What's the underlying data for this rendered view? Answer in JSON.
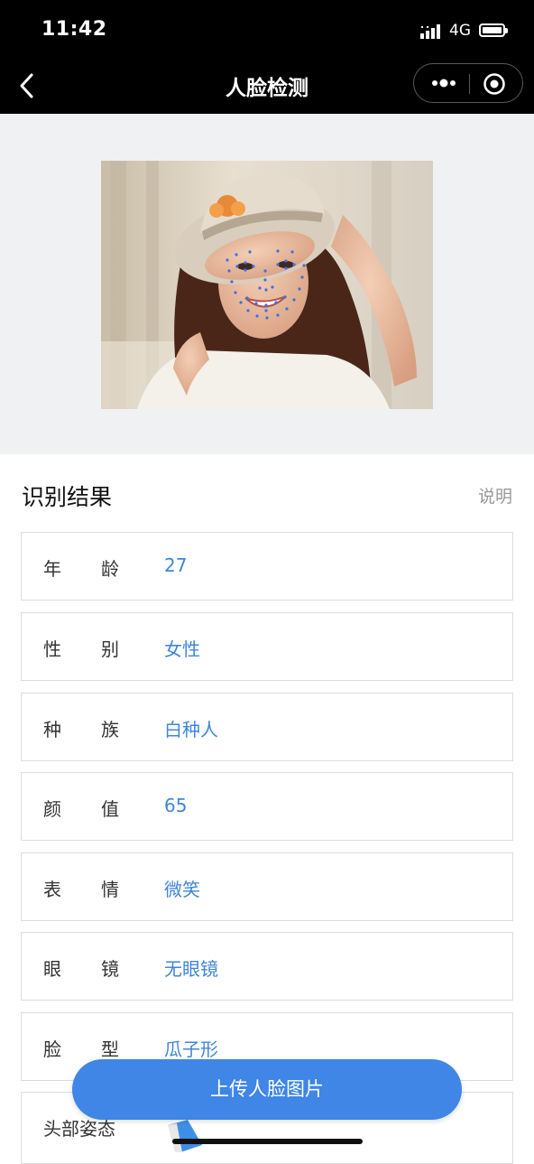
{
  "status_bar": {
    "time": "11:42",
    "network": "4G",
    "icons": [
      "signal-icon",
      "battery-icon"
    ]
  },
  "nav": {
    "title": "人脸检测",
    "icons": [
      "back-icon",
      "more-icon",
      "close-icon"
    ]
  },
  "results": {
    "title": "识别结果",
    "explain_label": "说明",
    "rows": [
      {
        "label_a": "年",
        "label_b": "龄",
        "value": "27"
      },
      {
        "label_a": "性",
        "label_b": "别",
        "value": "女性"
      },
      {
        "label_a": "种",
        "label_b": "族",
        "value": "白种人"
      },
      {
        "label_a": "颜",
        "label_b": "值",
        "value": "65"
      },
      {
        "label_a": "表",
        "label_b": "情",
        "value": "微笑"
      },
      {
        "label_a": "眼",
        "label_b": "镜",
        "value": "无眼镜"
      },
      {
        "label_a": "脸",
        "label_b": "型",
        "value": "瓜子形"
      },
      {
        "label_full": "头部姿态",
        "value": ""
      }
    ]
  },
  "upload_button": {
    "label": "上传人脸图片"
  },
  "colors": {
    "accent": "#3f86e6",
    "value_text": "#3f86d8",
    "bar_background": "#000000",
    "page_background": "#f0f1f3"
  }
}
